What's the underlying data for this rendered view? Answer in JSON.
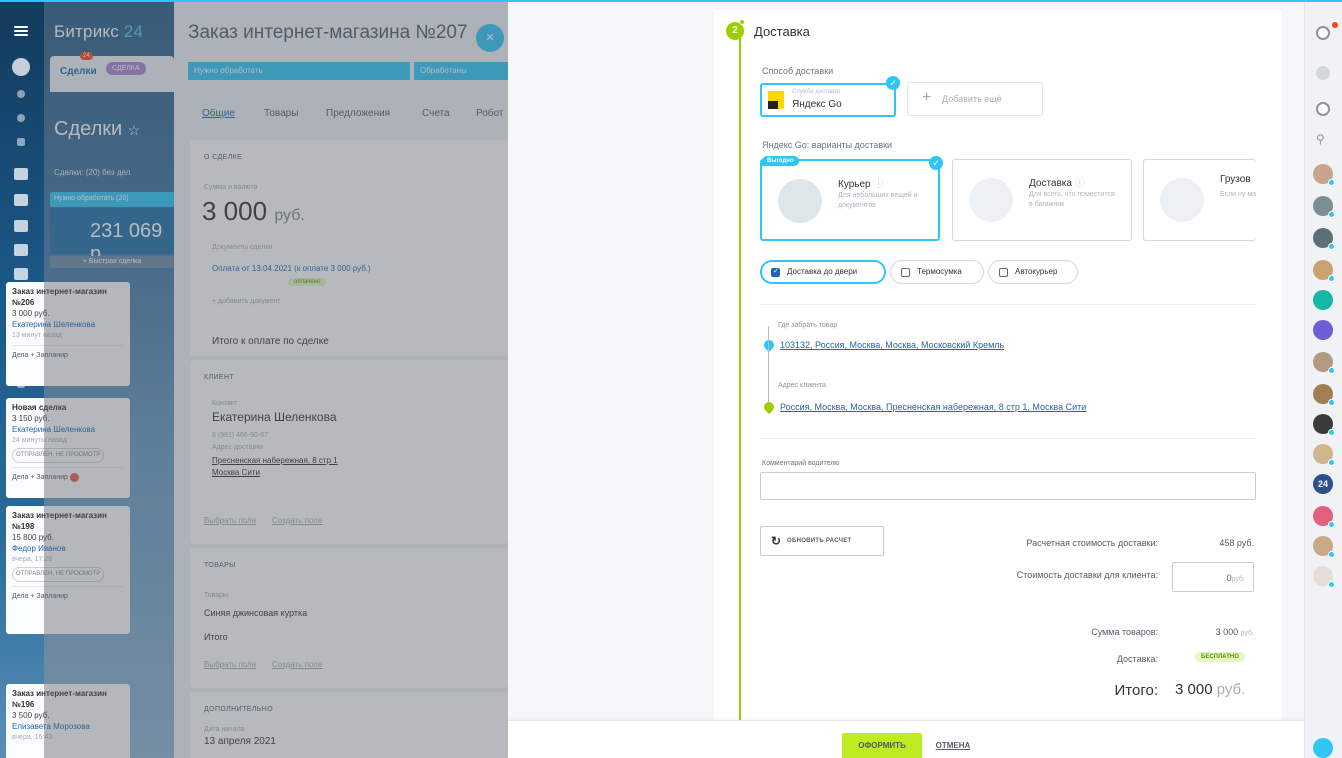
{
  "crm": {
    "logo_a": "Битрикс",
    "logo_b": " 24",
    "tab_deals": "Сделки",
    "tab_deals_count": "24",
    "tab_other": "СДЕЛКА",
    "title": "Сделки",
    "star": "☆",
    "subtitle": "Сделки: (20) без дел",
    "column": "Нужно обработать (20)",
    "column_sum": "231 069 р",
    "quick_add": "+ Быстрая сделка",
    "cards": [
      {
        "title": "Заказ интернет-магазин №206",
        "price": "3 000 руб.",
        "person": "Екатерина Шеленкова",
        "time": "13 минут назад",
        "status": "",
        "action": "Дела   + Запланир"
      },
      {
        "title": "Новая сделка",
        "price": "3 150 руб.",
        "person": "Екатерина Шеленкова",
        "time": "24 минуты назад",
        "status": "ОТПРАВЛЕН, НЕ ПРОСМОТР",
        "action": "Дела   + Запланир"
      },
      {
        "title": "Заказ интернет-магазин №198",
        "price": "15 800 руб.",
        "person": "Федор Иванов",
        "time": "вчера, 17:26",
        "status": "ОТПРАВЛЕН, НЕ ПРОСМОТР",
        "action": "Дела   + Запланир"
      },
      {
        "title": "Заказ интернет-магазин №196",
        "price": "3 500 руб.",
        "person": "Елизавета Морозова",
        "time": "вчера, 16:43",
        "status": "",
        "action": ""
      }
    ]
  },
  "order": {
    "title": "Заказ интернет-магазина №207",
    "close": "×",
    "stage1": "Нужно обработать",
    "stage2": "Обработаны",
    "tabs": [
      "Общие",
      "Товары",
      "Предложения",
      "Счета",
      "Робот"
    ],
    "about_header": "О СДЕЛКЕ",
    "amount_label": "Сумма и валюта",
    "amount": "3 000",
    "currency": "руб.",
    "docs_label": "Документы сделки",
    "payment_link": "Оплата от 13.04.2021 (к оплате 3 000 руб.)",
    "payment_status": "оплачено",
    "add_doc": "+ добавить документ",
    "total_to_pay": "Итого к оплате по сделке",
    "client_label": "Клиент",
    "contact_label": "Контакт",
    "contact_name": "Екатерина Шеленкова",
    "phone": "8 (981) 466-90-87",
    "delivery_addr_label": "Адрес доставки",
    "delivery_addr_1": "Пресненская набережная, 8 стр 1",
    "delivery_addr_2": "Москва Сити",
    "choose_field": "Выбрать поле",
    "create_field": "Создать поле",
    "goods_header": "ТОВАРЫ",
    "goods_label": "Товары",
    "goods_item": "Синяя джинсовая куртка",
    "goods_total": "Итого",
    "extra_header": "ДОПОЛНИТЕЛЬНО",
    "start_date_label": "Дата начала",
    "start_date": "13 апреля 2021"
  },
  "delivery": {
    "step": "2",
    "title": "Доставка",
    "method_label": "Способ доставки",
    "service_small": "Служба доставки",
    "service_name": "Яндекс Go",
    "add_more": "Добавить ещё",
    "variants_label": "Яндекс Go: варианты доставки",
    "badge": "Выгодно",
    "options": [
      {
        "name": "Курьер",
        "desc": "Для небольших вещей и документов",
        "selected": true
      },
      {
        "name": "Доставка",
        "desc": "Для всего, что поместится в багажник",
        "selected": false
      },
      {
        "name": "Грузов",
        "desc": "Если ну машин",
        "selected": false
      }
    ],
    "extras": [
      {
        "label": "Доставка до двери",
        "checked": true
      },
      {
        "label": "Термосумка",
        "checked": false
      },
      {
        "label": "Автокурьер",
        "checked": false
      }
    ],
    "pickup_label": "Где забрать товар",
    "pickup_addr": "103132, Россия, Москва, Москва, Московский Кремль",
    "client_addr_label": "Адрес клиента",
    "client_addr": "Россия, Москва, Москва, Пресненская набережная, 8 стр 1, Москва Сити",
    "comment_label": "Комментарий водителю",
    "comment_value": "",
    "update_btn": "ОБНОВИТЬ РАСЧЕТ",
    "calc_cost_label": "Расчетная стоимость доставки:",
    "calc_cost": "458 руб.",
    "client_cost_label": "Стоимость доставки для клиента:",
    "client_cost": "0",
    "client_cost_unit": "руб.",
    "goods_sum_label": "Сумма товаров:",
    "goods_sum": "3 000",
    "goods_sum_unit": "руб.",
    "delivery_label": "Доставка:",
    "delivery_value": "БЕСПЛАТНО",
    "total_label": "Итого:",
    "total_value": "3 000",
    "total_unit": "руб."
  },
  "footer": {
    "submit": "ОФОРМИТЬ",
    "cancel": "ОТМЕНА"
  },
  "sidebar": {
    "chat_counter": "24"
  },
  "colors": {
    "accent": "#2fc6f6",
    "green": "#9dcf00",
    "submit": "#bbed21",
    "link": "#2067b0"
  }
}
